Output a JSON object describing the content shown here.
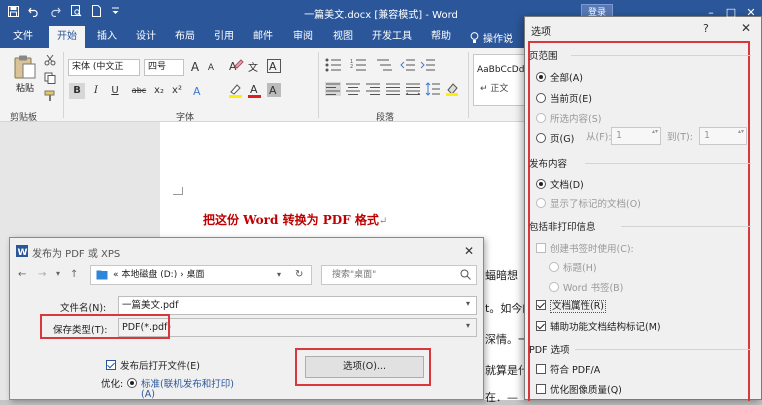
{
  "window": {
    "title": "一篇美文.docx [兼容模式] - Word",
    "login": "登录"
  },
  "ribbon_tabs": [
    "文件",
    "开始",
    "插入",
    "设计",
    "布局",
    "引用",
    "邮件",
    "审阅",
    "视图",
    "开发工具",
    "帮助"
  ],
  "tell_me": "操作说",
  "ribbon": {
    "paste_label": "粘贴",
    "font_name": "宋体 (中文正",
    "font_size": "四号",
    "grow_font": "A",
    "shrink_font": "A",
    "format_buttons": [
      "B",
      "I",
      "U",
      "abc",
      "x₂",
      "x²"
    ],
    "style_sample": "AaBbCcDd",
    "style_name": "↵ 正文",
    "groups": {
      "clipboard": "剪贴板",
      "font": "字体",
      "paragraph": "段落"
    }
  },
  "document": {
    "heading": "把这份 Word 转换为 PDF 格式",
    "fragments": [
      "蝠暗想",
      "t。如今的",
      "深情。一",
      "就算是什",
      "在．—"
    ]
  },
  "publish": {
    "title": "发布为 PDF 或 XPS",
    "breadcrumb": "«  本地磁盘 (D:)  ›  桌面",
    "search_placeholder": "搜索\"桌面\"",
    "filename_label": "文件名(N):",
    "filename_value": "一篇美文.pdf",
    "savetype_label": "保存类型(T):",
    "savetype_value": "PDF(*.pdf)",
    "open_after": "发布后打开文件(E)",
    "optimize_label": "优化:",
    "optimize_value": "标准(联机发布和打印)",
    "optimize_suffix": "(A)",
    "options_button": "选项(O)..."
  },
  "options": {
    "title": "选项",
    "page_range_title": "页范围",
    "all": "全部(A)",
    "current": "当前页(E)",
    "selection": "所选内容(S)",
    "pages": "页(G)",
    "from_label": "从(F):",
    "from_value": "1",
    "to_label": "到(T):",
    "to_value": "1",
    "publish_what_title": "发布内容",
    "document": "文档(D)",
    "markup": "显示了标记的文档(O)",
    "nonprint_title": "包括非打印信息",
    "bookmarks": "创建书签时使用(C):",
    "headings": "标题(H)",
    "word_bookmarks": "Word 书签(B)",
    "doc_props": "文档属性(R)",
    "struct_tags": "辅助功能文档结构标记(M)",
    "pdf_title": "PDF 选项",
    "pdfa": "符合 PDF/A",
    "image_quality": "优化图像质量(Q)"
  }
}
